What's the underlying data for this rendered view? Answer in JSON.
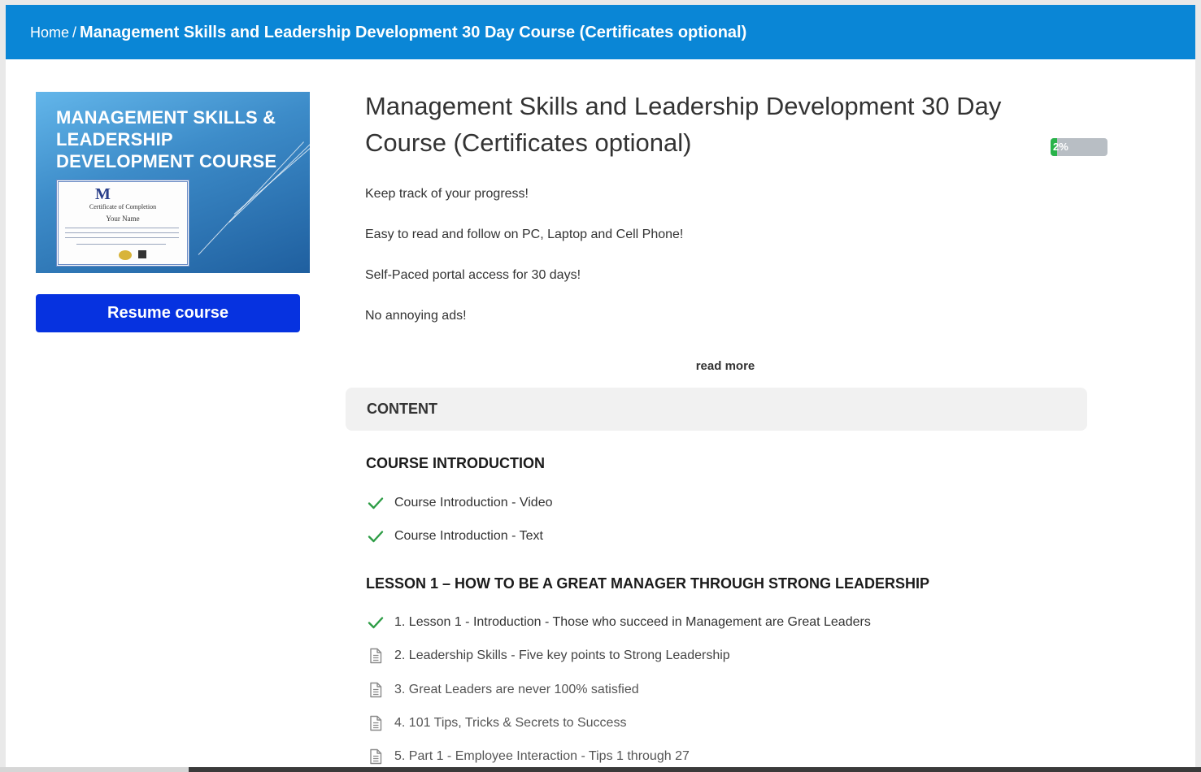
{
  "breadcrumb": {
    "home": "Home",
    "separator": "/",
    "current": "Management Skills and Leadership Development 30 Day Course (Certificates optional)"
  },
  "sidebar": {
    "thumbnail": {
      "title_lines": [
        "MANAGEMENT SKILLS &",
        "LEADERSHIP",
        "DEVELOPMENT COURSE"
      ],
      "certificate": {
        "heading": "Certificate of Completion",
        "name": "Your Name"
      }
    },
    "resume_label": "Resume course"
  },
  "course": {
    "title": "Management Skills and Leadership Development 30 Day Course (Certificates optional)",
    "progress": {
      "percent": 2,
      "label": "2%"
    },
    "description": [
      "Keep track of your progress!",
      "Easy to read and follow on PC, Laptop and Cell Phone!",
      "Self-Paced portal access for 30 days!",
      "No annoying ads!"
    ],
    "read_more": "read more"
  },
  "content": {
    "header": "CONTENT",
    "sections": [
      {
        "title": "COURSE INTRODUCTION",
        "items": [
          {
            "label": "Course Introduction - Video",
            "status": "completed",
            "icon": "checkmark-icon"
          },
          {
            "label": "Course Introduction - Text",
            "status": "completed",
            "icon": "checkmark-icon"
          }
        ]
      },
      {
        "title": "LESSON 1 – HOW TO BE A GREAT MANAGER THROUGH STRONG LEADERSHIP",
        "items": [
          {
            "label": "1. Lesson 1 - Introduction - Those who succeed in Management are Great Leaders",
            "status": "completed",
            "icon": "checkmark-icon"
          },
          {
            "label": "2. Leadership Skills - Five key points to Strong Leadership",
            "status": "not-started",
            "icon": "document-icon"
          },
          {
            "label": "3. Great Leaders are never 100% satisfied",
            "status": "not-started",
            "icon": "document-icon"
          },
          {
            "label": "4. 101 Tips, Tricks & Secrets to Success",
            "status": "not-started",
            "icon": "document-icon"
          },
          {
            "label": "5. Part 1 - Employee Interaction - Tips 1 through 27",
            "status": "not-started",
            "icon": "document-icon"
          }
        ]
      }
    ]
  },
  "colors": {
    "header_bar": "#0a86d6",
    "resume_button": "#0632e0",
    "progress_fill": "#29b34a",
    "progress_track": "#b8bec4",
    "checkmark": "#2e9d46"
  }
}
